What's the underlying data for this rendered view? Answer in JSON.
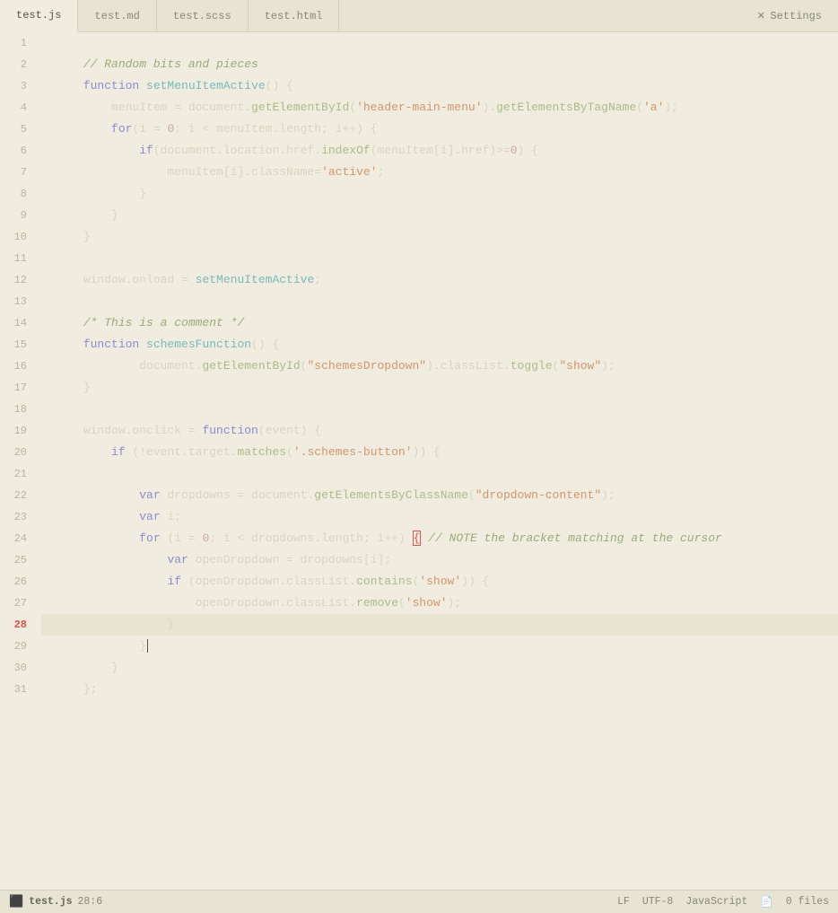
{
  "tabs": [
    {
      "label": "test.js",
      "active": true
    },
    {
      "label": "test.md",
      "active": false
    },
    {
      "label": "test.scss",
      "active": false
    },
    {
      "label": "test.html",
      "active": false
    }
  ],
  "settings_label": "Settings",
  "lines": [
    {
      "num": 1,
      "active": false
    },
    {
      "num": 2,
      "active": false
    },
    {
      "num": 3,
      "active": false
    },
    {
      "num": 4,
      "active": false
    },
    {
      "num": 5,
      "active": false
    },
    {
      "num": 6,
      "active": false
    },
    {
      "num": 7,
      "active": false
    },
    {
      "num": 8,
      "active": false
    },
    {
      "num": 9,
      "active": false
    },
    {
      "num": 10,
      "active": false
    },
    {
      "num": 11,
      "active": false
    },
    {
      "num": 12,
      "active": false
    },
    {
      "num": 13,
      "active": false
    },
    {
      "num": 14,
      "active": false
    },
    {
      "num": 15,
      "active": false
    },
    {
      "num": 16,
      "active": false
    },
    {
      "num": 17,
      "active": false
    },
    {
      "num": 18,
      "active": false
    },
    {
      "num": 19,
      "active": false
    },
    {
      "num": 20,
      "active": false
    },
    {
      "num": 21,
      "active": false
    },
    {
      "num": 22,
      "active": false
    },
    {
      "num": 23,
      "active": false
    },
    {
      "num": 24,
      "active": false
    },
    {
      "num": 25,
      "active": false
    },
    {
      "num": 26,
      "active": false
    },
    {
      "num": 27,
      "active": false
    },
    {
      "num": 28,
      "active": true
    },
    {
      "num": 29,
      "active": false
    },
    {
      "num": 30,
      "active": false
    },
    {
      "num": 31,
      "active": false
    }
  ],
  "status": {
    "file": "test.js",
    "position": "28:6",
    "encoding": "LF",
    "charset": "UTF-8",
    "language": "JavaScript",
    "files": "0 files"
  }
}
